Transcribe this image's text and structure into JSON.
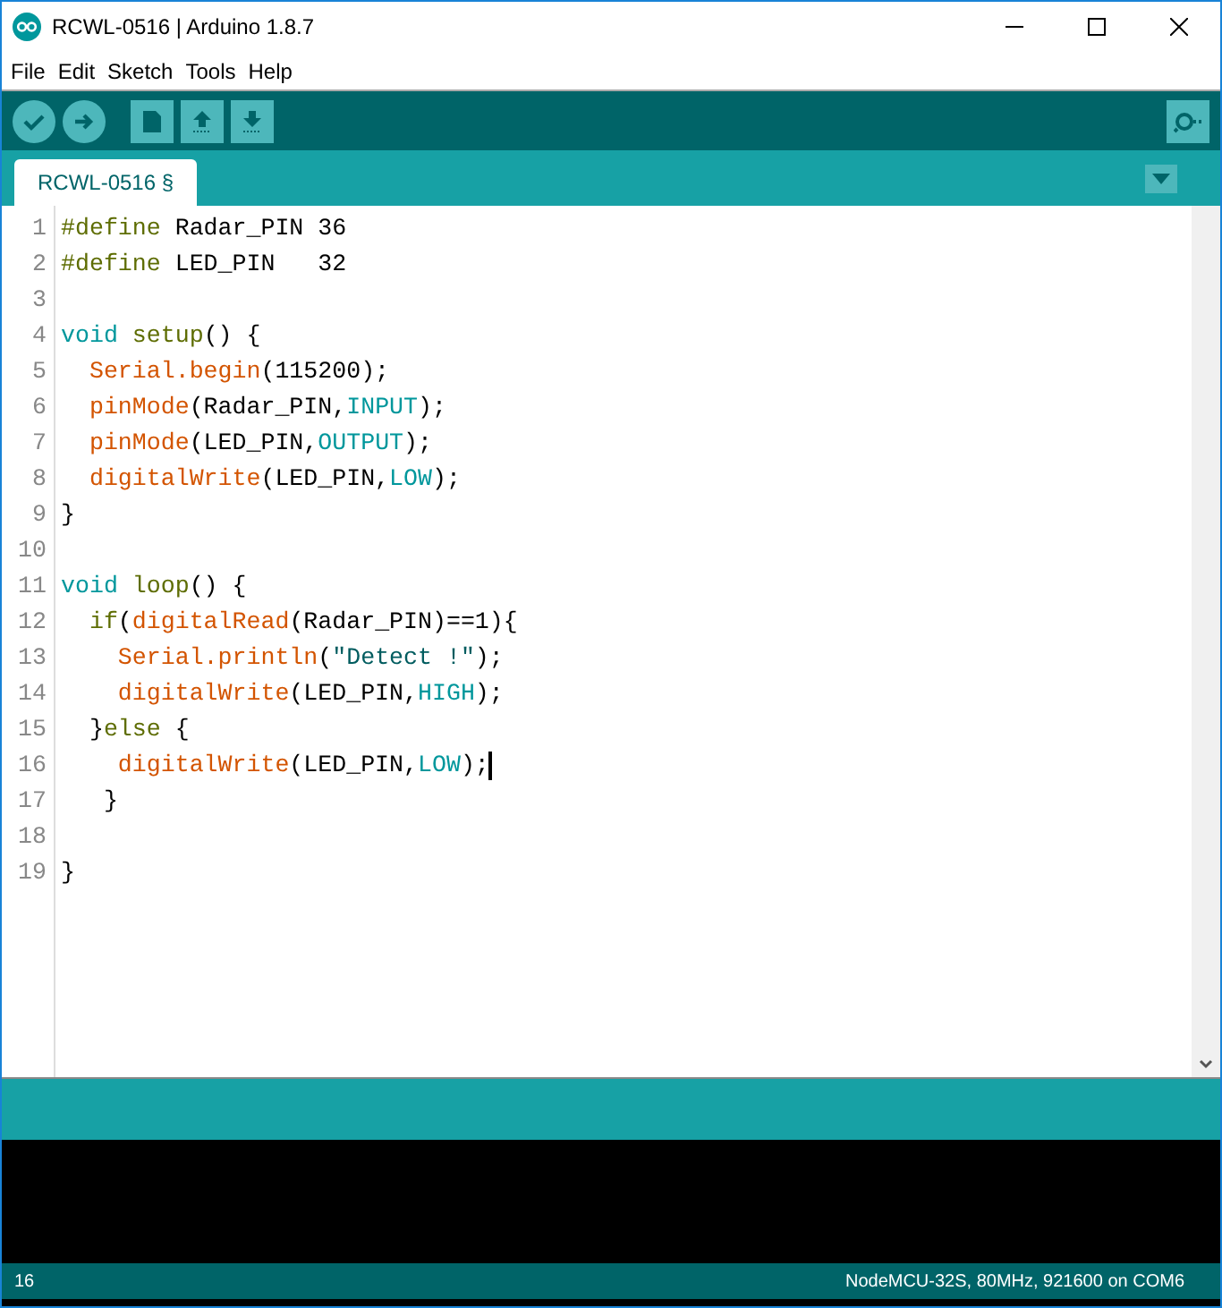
{
  "window": {
    "title": "RCWL-0516 | Arduino 1.8.7"
  },
  "menu": [
    "File",
    "Edit",
    "Sketch",
    "Tools",
    "Help"
  ],
  "tabs": [
    {
      "label": "RCWL-0516 §",
      "selected": true
    }
  ],
  "editor": {
    "lines": [
      {
        "number": "1",
        "cursor": false,
        "tokens": [
          {
            "kind": "keyword",
            "text": "#define"
          },
          {
            "kind": "plain",
            "text": " Radar_PIN 36"
          }
        ]
      },
      {
        "number": "2",
        "cursor": false,
        "tokens": [
          {
            "kind": "keyword",
            "text": "#define"
          },
          {
            "kind": "plain",
            "text": " LED_PIN   32"
          }
        ]
      },
      {
        "number": "3",
        "cursor": false
      },
      {
        "number": "4",
        "cursor": false,
        "tokens": [
          {
            "kind": "type",
            "text": "void "
          },
          {
            "kind": "keyword",
            "text": "setup"
          },
          {
            "kind": "plain",
            "text": "() {"
          }
        ]
      },
      {
        "number": "5",
        "cursor": false,
        "tokens": [
          {
            "kind": "function",
            "text": "  Serial.begin"
          },
          {
            "kind": "plain",
            "text": "(115200);"
          }
        ]
      },
      {
        "number": "6",
        "cursor": false,
        "tokens": [
          {
            "kind": "function",
            "text": "  pinMode"
          },
          {
            "kind": "plain",
            "text": "(Radar_PIN,"
          },
          {
            "kind": "constant",
            "text": "INPUT"
          },
          {
            "kind": "plain",
            "text": ");"
          }
        ]
      },
      {
        "number": "7",
        "cursor": false,
        "tokens": [
          {
            "kind": "function",
            "text": "  pinMode"
          },
          {
            "kind": "plain",
            "text": "(LED_PIN,"
          },
          {
            "kind": "constant",
            "text": "OUTPUT"
          },
          {
            "kind": "plain",
            "text": ");"
          }
        ]
      },
      {
        "number": "8",
        "cursor": false,
        "tokens": [
          {
            "kind": "function",
            "text": "  digitalWrite"
          },
          {
            "kind": "plain",
            "text": "(LED_PIN,"
          },
          {
            "kind": "constant",
            "text": "LOW"
          },
          {
            "kind": "plain",
            "text": ");"
          }
        ]
      },
      {
        "number": "9",
        "cursor": false,
        "tokens": [
          {
            "kind": "plain",
            "text": "}"
          }
        ]
      },
      {
        "number": "10",
        "cursor": false
      },
      {
        "number": "11",
        "cursor": false,
        "tokens": [
          {
            "kind": "type",
            "text": "void "
          },
          {
            "kind": "keyword",
            "text": "loop"
          },
          {
            "kind": "plain",
            "text": "() {"
          }
        ]
      },
      {
        "number": "12",
        "cursor": false,
        "tokens": [
          {
            "kind": "keyword",
            "text": "  if"
          },
          {
            "kind": "plain",
            "text": "("
          },
          {
            "kind": "function",
            "text": "digitalRead"
          },
          {
            "kind": "plain",
            "text": "(Radar_PIN)==1){"
          }
        ]
      },
      {
        "number": "13",
        "cursor": false,
        "tokens": [
          {
            "kind": "function",
            "text": "    Serial.println"
          },
          {
            "kind": "plain",
            "text": "("
          },
          {
            "kind": "string",
            "text": "\"Detect !\""
          },
          {
            "kind": "plain",
            "text": ");"
          }
        ]
      },
      {
        "number": "14",
        "cursor": false,
        "tokens": [
          {
            "kind": "function",
            "text": "    digitalWrite"
          },
          {
            "kind": "plain",
            "text": "(LED_PIN,"
          },
          {
            "kind": "constant",
            "text": "HIGH"
          },
          {
            "kind": "plain",
            "text": ");"
          }
        ]
      },
      {
        "number": "15",
        "cursor": false,
        "tokens": [
          {
            "kind": "plain",
            "text": "  }"
          },
          {
            "kind": "keyword",
            "text": "else"
          },
          {
            "kind": "plain",
            "text": " {"
          }
        ]
      },
      {
        "number": "16",
        "cursor": true,
        "tokens": [
          {
            "kind": "function",
            "text": "    digitalWrite"
          },
          {
            "kind": "plain",
            "text": "(LED_PIN,"
          },
          {
            "kind": "constant",
            "text": "LOW"
          },
          {
            "kind": "plain",
            "text": ");"
          }
        ]
      },
      {
        "number": "17",
        "cursor": false,
        "tokens": [
          {
            "kind": "plain",
            "text": "   }"
          }
        ]
      },
      {
        "number": "18",
        "cursor": false
      },
      {
        "number": "19",
        "cursor": false,
        "tokens": [
          {
            "kind": "plain",
            "text": "}"
          }
        ]
      }
    ]
  },
  "status_bar": {
    "line": "16",
    "board": "NodeMCU-32S, 80MHz, 921600 on COM6"
  }
}
